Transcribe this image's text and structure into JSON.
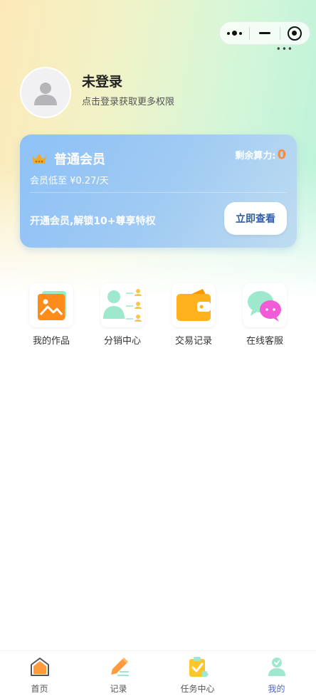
{
  "capsule": {
    "more_icon": "more-icon",
    "minimize_icon": "minimize-icon",
    "close_icon": "target-icon"
  },
  "user": {
    "name": "未登录",
    "subtitle": "点击登录获取更多权限"
  },
  "member_card": {
    "title": "普通会员",
    "compute_label": "剩余算力:",
    "compute_value": "0",
    "price_text": "会员低至 ¥0.27/天",
    "promo_text": "开通会员,解锁10+尊享特权",
    "button_label": "立即查看",
    "colors": {
      "accent": "#ff8a3d",
      "button_text": "#2f5fa6"
    }
  },
  "features": [
    {
      "label": "我的作品",
      "icon": "image-icon"
    },
    {
      "label": "分销中心",
      "icon": "distribution-icon"
    },
    {
      "label": "交易记录",
      "icon": "wallet-icon"
    },
    {
      "label": "在线客服",
      "icon": "chat-icon"
    }
  ],
  "tabbar": {
    "items": [
      {
        "label": "首页",
        "icon": "home-icon",
        "active": false
      },
      {
        "label": "记录",
        "icon": "pencil-icon",
        "active": false
      },
      {
        "label": "任务中心",
        "icon": "clipboard-icon",
        "active": false
      },
      {
        "label": "我的",
        "icon": "user-icon",
        "active": true
      }
    ],
    "active_color": "#4a67c9"
  }
}
